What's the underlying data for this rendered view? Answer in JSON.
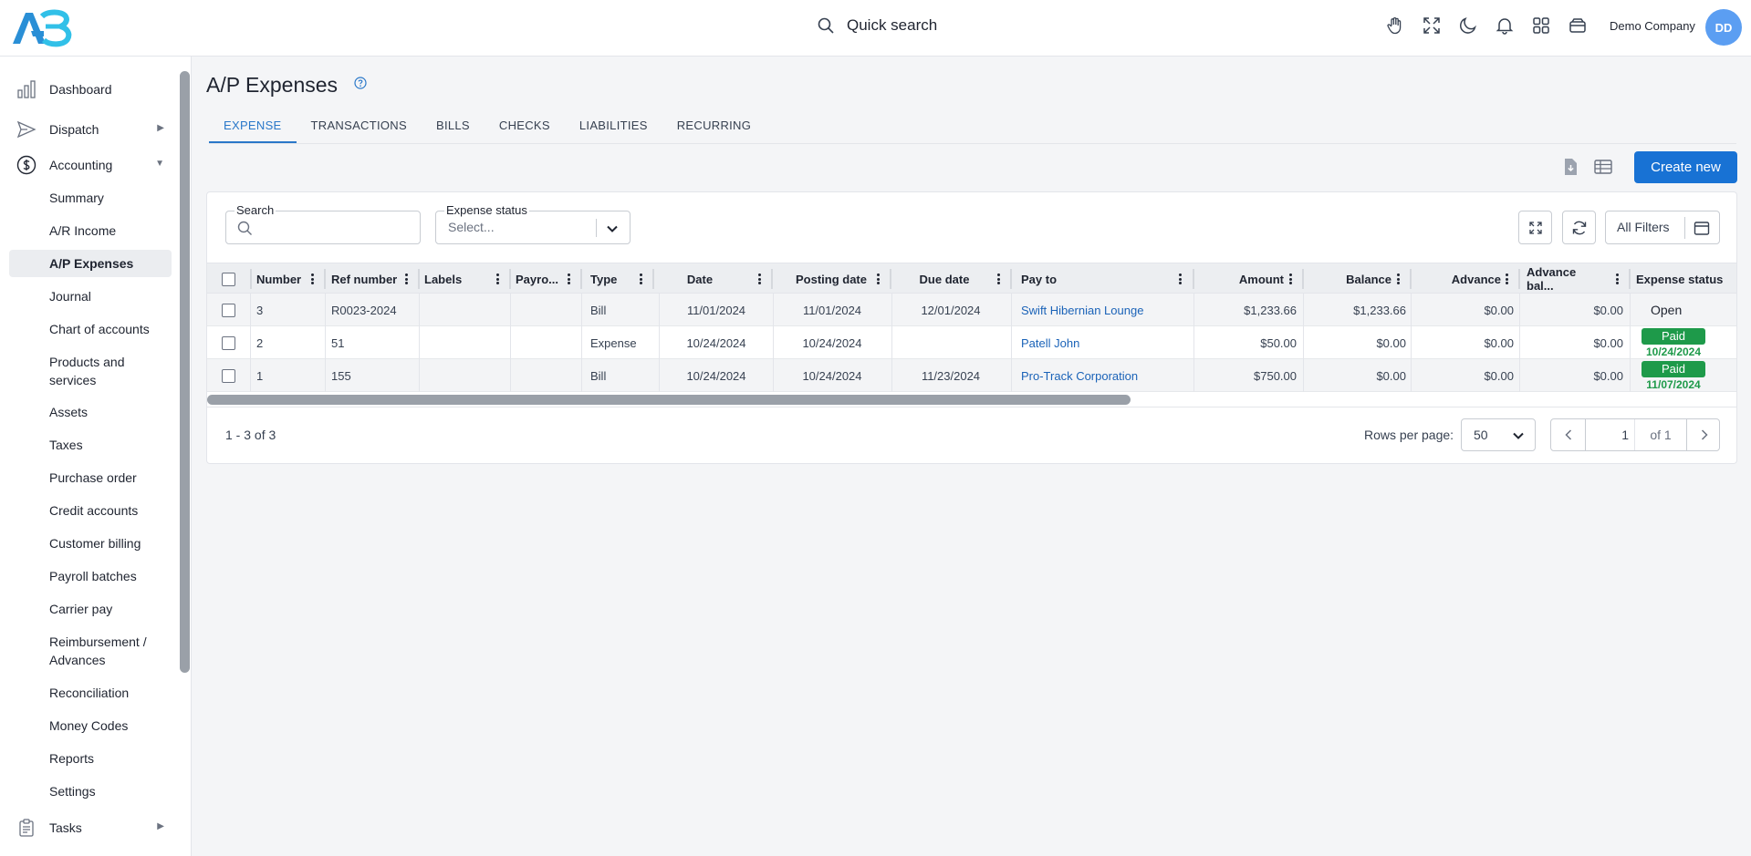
{
  "header": {
    "quick_search": "Quick search",
    "company": "Demo Company",
    "avatar_initials": "DD",
    "icons": [
      "hand-icon",
      "fullscreen-icon",
      "dark-mode-icon",
      "notifications-icon",
      "apps-grid-icon",
      "wallet-icon"
    ]
  },
  "sidebar": {
    "items": [
      {
        "label": "Dashboard",
        "icon": "chart-bars-icon"
      },
      {
        "label": "Dispatch",
        "icon": "send-icon"
      },
      {
        "label": "Accounting",
        "icon": "dollar-icon"
      },
      {
        "label": "Summary"
      },
      {
        "label": "A/R Income"
      },
      {
        "label": "A/P Expenses",
        "active": true
      },
      {
        "label": "Journal"
      },
      {
        "label": "Chart of accounts"
      },
      {
        "label": "Products and services"
      },
      {
        "label": "Assets"
      },
      {
        "label": "Taxes"
      },
      {
        "label": "Purchase order"
      },
      {
        "label": "Credit accounts"
      },
      {
        "label": "Customer billing"
      },
      {
        "label": "Payroll batches"
      },
      {
        "label": "Carrier pay"
      },
      {
        "label": "Reimbursement / Advances"
      },
      {
        "label": "Reconciliation"
      },
      {
        "label": "Money Codes"
      },
      {
        "label": "Reports"
      },
      {
        "label": "Settings"
      },
      {
        "label": "Tasks",
        "icon": "clipboard-icon"
      }
    ]
  },
  "page": {
    "title": "A/P Expenses",
    "tabs": [
      "EXPENSE",
      "TRANSACTIONS",
      "BILLS",
      "CHECKS",
      "LIABILITIES",
      "RECURRING"
    ],
    "active_tab": "EXPENSE",
    "create_button": "Create new"
  },
  "filters": {
    "search_label": "Search",
    "status_label": "Expense status",
    "status_placeholder": "Select...",
    "all_filters": "All Filters"
  },
  "table": {
    "columns": [
      "Number",
      "Ref number",
      "Labels",
      "Payro...",
      "Type",
      "Date",
      "Posting date",
      "Due date",
      "Pay to",
      "Amount",
      "Balance",
      "Advance",
      "Advance bal...",
      "Expense status"
    ],
    "rows": [
      {
        "number": "3",
        "ref": "R0023-2024",
        "labels": "",
        "payroll": "",
        "type": "Bill",
        "date": "11/01/2024",
        "posting_date": "11/01/2024",
        "due_date": "12/01/2024",
        "pay_to": "Swift Hibernian Lounge",
        "amount": "$1,233.66",
        "balance": "$1,233.66",
        "advance": "$0.00",
        "advance_bal": "$0.00",
        "status": "Open",
        "status_date": ""
      },
      {
        "number": "2",
        "ref": "51",
        "labels": "",
        "payroll": "",
        "type": "Expense",
        "date": "10/24/2024",
        "posting_date": "10/24/2024",
        "due_date": "",
        "pay_to": "Patell John",
        "amount": "$50.00",
        "balance": "$0.00",
        "advance": "$0.00",
        "advance_bal": "$0.00",
        "status": "Paid",
        "status_date": "10/24/2024"
      },
      {
        "number": "1",
        "ref": "155",
        "labels": "",
        "payroll": "",
        "type": "Bill",
        "date": "10/24/2024",
        "posting_date": "10/24/2024",
        "due_date": "11/23/2024",
        "pay_to": "Pro-Track Corporation",
        "amount": "$750.00",
        "balance": "$0.00",
        "advance": "$0.00",
        "advance_bal": "$0.00",
        "status": "Paid",
        "status_date": "11/07/2024"
      }
    ]
  },
  "pagination": {
    "count_text": "1 - 3 of 3",
    "rows_per_page_label": "Rows per page:",
    "rows_per_page": "50",
    "page": "1",
    "of_text": "of 1"
  },
  "colors": {
    "accent": "#1872d4",
    "link": "#1b63b8",
    "paid": "#1e9a4a"
  }
}
